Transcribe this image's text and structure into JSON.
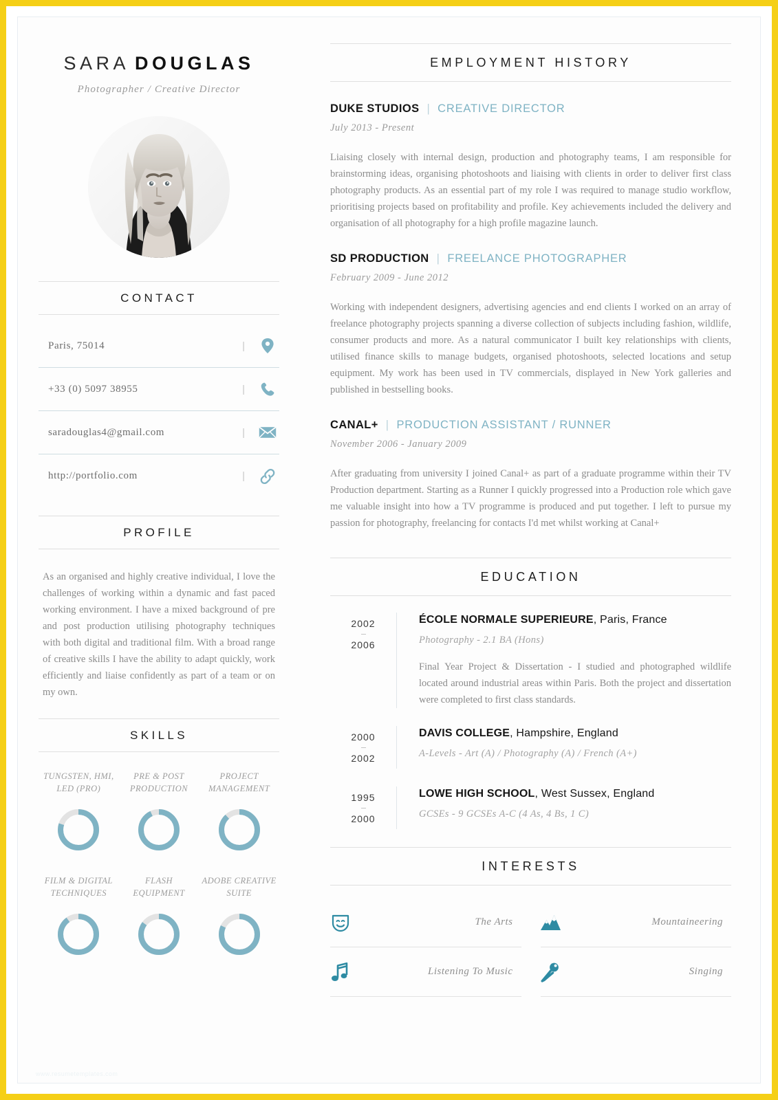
{
  "theme": {
    "accent": "#7fb3c4",
    "icon_accent": "#2e8ba3",
    "border_gold": "#f5cf17",
    "text_dark": "#151515",
    "text_muted": "#8b8b8b"
  },
  "header": {
    "first_name": "SARA",
    "last_name": "DOUGLAS",
    "job_title": "Photographer / Creative Director"
  },
  "contact": {
    "heading": "CONTACT",
    "separator": "|",
    "items": [
      {
        "value": "Paris, 75014",
        "icon": "location-pin-icon"
      },
      {
        "value": "+33 (0) 5097 38955",
        "icon": "phone-icon"
      },
      {
        "value": "saradouglas4@gmail.com",
        "icon": "envelope-icon"
      },
      {
        "value": "http://portfolio.com",
        "icon": "link-icon"
      }
    ]
  },
  "profile": {
    "heading": "PROFILE",
    "body": "As an organised and highly creative individual, I love the challenges of working within a dynamic and fast paced working environment. I have a mixed background of pre and post production utilising photography techniques with both digital and traditional film. With a broad range of creative skills I have the ability to adapt quickly, work efficiently and liaise confidently as part of a team or on my own."
  },
  "skills": {
    "heading": "SKILLS",
    "items": [
      {
        "label": "TUNGSTEN, HMI, LED (PRO)",
        "percent": 80
      },
      {
        "label": "PRE & POST PRODUCTION",
        "percent": 93
      },
      {
        "label": "PROJECT MANAGEMENT",
        "percent": 88
      },
      {
        "label": "FILM & DIGITAL TECHNIQUES",
        "percent": 90
      },
      {
        "label": "FLASH EQUIPMENT",
        "percent": 85
      },
      {
        "label": "ADOBE CREATIVE SUITE",
        "percent": 82
      }
    ]
  },
  "employment": {
    "heading": "EMPLOYMENT HISTORY",
    "jobs": [
      {
        "company": "DUKE STUDIOS",
        "role": "CREATIVE DIRECTOR",
        "dates": "July 2013 - Present",
        "description": "Liaising closely with internal design, production and photography teams, I am responsible for brainstorming ideas, organising photoshoots and liaising with clients in order to deliver first class photography products.  As an essential part of my role I was required to manage studio workflow, prioritising projects based on profitability and profile.  Key achievements included the delivery and organisation of all photography for a high profile magazine launch."
      },
      {
        "company": "SD PRODUCTION",
        "role": "FREELANCE PHOTOGRAPHER",
        "dates": "February 2009 - June 2012",
        "description": "Working with independent designers, advertising agencies and end clients I worked on an array of freelance photography projects spanning a diverse collection of subjects including fashion, wildlife, consumer products and more.  As a natural communicator I built key relationships with clients, utilised finance skills to manage budgets, organised photoshoots, selected locations and setup equipment.   My work has been used in TV commercials, displayed in New York galleries and published in bestselling books."
      },
      {
        "company": "CANAL+",
        "role": "PRODUCTION ASSISTANT / RUNNER",
        "dates": "November 2006 - January 2009",
        "description": "After graduating from university I joined Canal+ as part of a graduate programme within their TV Production department.  Starting as a Runner I quickly progressed into a Production role which gave me valuable insight into how a TV programme is produced and put together. I left to pursue my passion for photography, freelancing for contacts I'd met whilst working at Canal+"
      }
    ]
  },
  "education": {
    "heading": "EDUCATION",
    "entries": [
      {
        "start_year": "2002",
        "end_year": "2006",
        "school": "ÉCOLE NORMALE SUPERIEURE",
        "location": ", Paris, France",
        "qualification": "Photography - 2.1 BA (Hons)",
        "note": "Final Year Project & Dissertation - I studied and photographed wildlife located around industrial areas within Paris. Both the project and dissertation were completed to first class standards."
      },
      {
        "start_year": "2000",
        "end_year": "2002",
        "school": "DAVIS COLLEGE",
        "location": ", Hampshire, England",
        "qualification": "A-Levels - Art (A) / Photography (A) / French (A+)",
        "note": ""
      },
      {
        "start_year": "1995",
        "end_year": "2000",
        "school": "LOWE HIGH SCHOOL",
        "location": ", West Sussex, England",
        "qualification": "GCSEs - 9 GCSEs A-C (4 As, 4 Bs, 1 C)",
        "note": ""
      }
    ]
  },
  "interests": {
    "heading": "INTERESTS",
    "items": [
      {
        "label": "The Arts",
        "icon": "theatre-mask-icon"
      },
      {
        "label": "Mountaineering",
        "icon": "mountain-icon"
      },
      {
        "label": "Listening To Music",
        "icon": "music-note-icon"
      },
      {
        "label": "Singing",
        "icon": "microphone-icon"
      }
    ]
  },
  "footer": {
    "watermark": "www.resumetemplates.com"
  }
}
